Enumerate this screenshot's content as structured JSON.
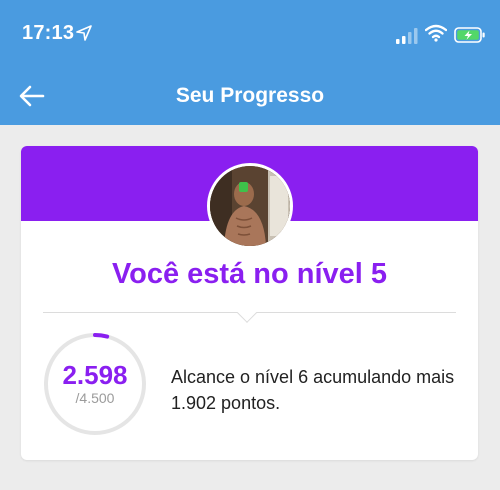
{
  "status_bar": {
    "time": "17:13",
    "icons": [
      "location-arrow-icon",
      "signal-icon",
      "wifi-icon",
      "battery-charging-icon"
    ]
  },
  "nav": {
    "title": "Seu Progresso",
    "back_icon": "arrow-left-icon"
  },
  "colors": {
    "header_blue": "#4a9be0",
    "accent_purple": "#8a1ff0",
    "ring_track": "#e5e5e5",
    "battery_green": "#53d769"
  },
  "progress": {
    "level_title": "Você está no nível 5",
    "points": "2.598",
    "goal": "/4.500",
    "ring_fraction": 0.04,
    "message": "Alcance o nível 6 acumulando mais 1.902 pontos."
  }
}
